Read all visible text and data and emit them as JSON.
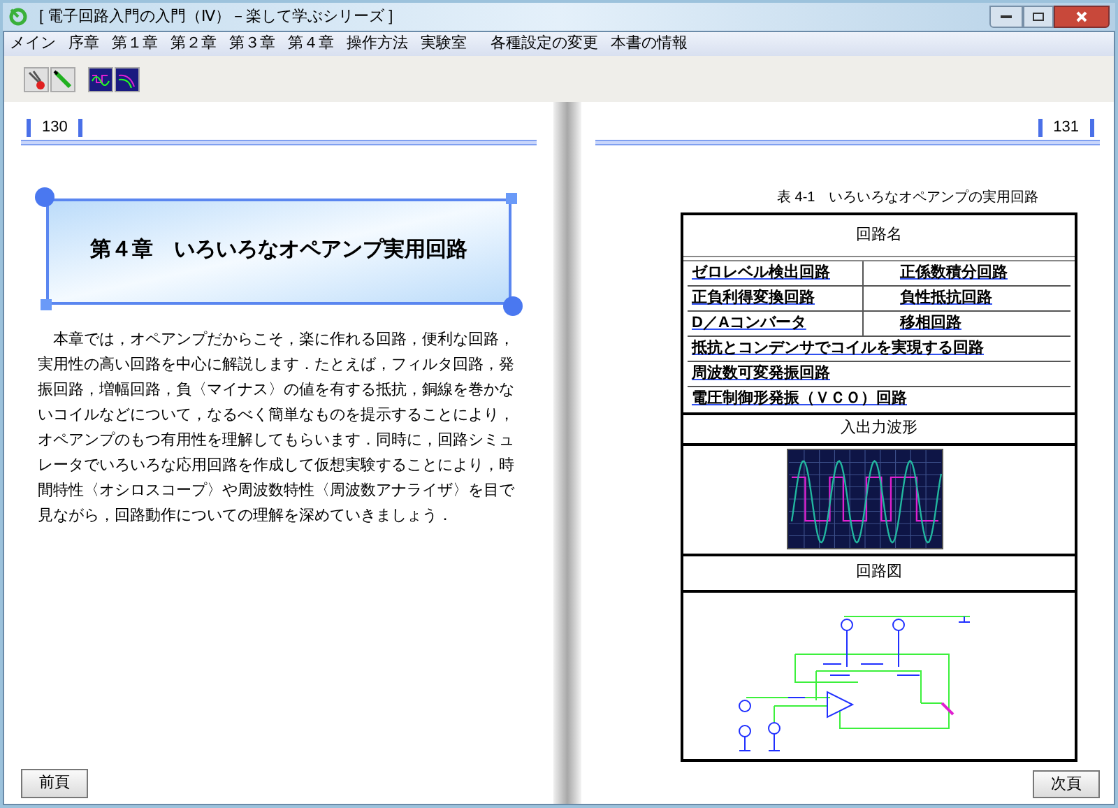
{
  "window": {
    "title": "[ 電子回路入門の入門（Ⅳ）－楽して学ぶシリーズ ]"
  },
  "menu": [
    "メイン",
    "序章",
    "第１章",
    "第２章",
    "第３章",
    "第４章",
    "操作方法",
    "実験室",
    "各種設定の変更",
    "本書の情報"
  ],
  "left_page": {
    "page_number": "130",
    "chapter_title": "第４章　いろいろなオペアンプ実用回路",
    "body": "　本章では，オペアンプだからこそ，楽に作れる回路，便利な回路，実用性の高い回路を中心に解説します．たとえば，フィルタ回路，発振回路，増幅回路，負〈マイナス〉の値を有する抵抗，銅線を巻かないコイルなどについて，なるべく簡単なものを提示することにより，オペアンプのもつ有用性を理解してもらいます．同時に，回路シミュレータでいろいろな応用回路を作成して仮想実験することにより，時間特性〈オシロスコープ〉や周波数特性〈周波数アナライザ〉を目で見ながら，回路動作についての理解を深めていきましょう．",
    "button": "前頁"
  },
  "right_page": {
    "page_number": "131",
    "caption": "表 4-1　いろいろなオペアンプの実用回路",
    "table": {
      "header": "回路名",
      "link_rows": [
        {
          "cells": [
            "ゼロレベル検出回路",
            "正係数積分回路"
          ]
        },
        {
          "cells": [
            "正負利得変換回路",
            "負性抵抗回路"
          ]
        },
        {
          "cells": [
            "D／Aコンバータ",
            "移相回路"
          ]
        },
        {
          "cells": [
            "抵抗とコンデンサでコイルを実現する回路"
          ]
        },
        {
          "cells": [
            "周波数可変発振回路"
          ]
        },
        {
          "cells": [
            "電圧制御形発振（ＶＣＯ）回路"
          ]
        }
      ],
      "waveform_header": "入出力波形",
      "schematic_header": "回路図"
    },
    "button": "次頁"
  }
}
